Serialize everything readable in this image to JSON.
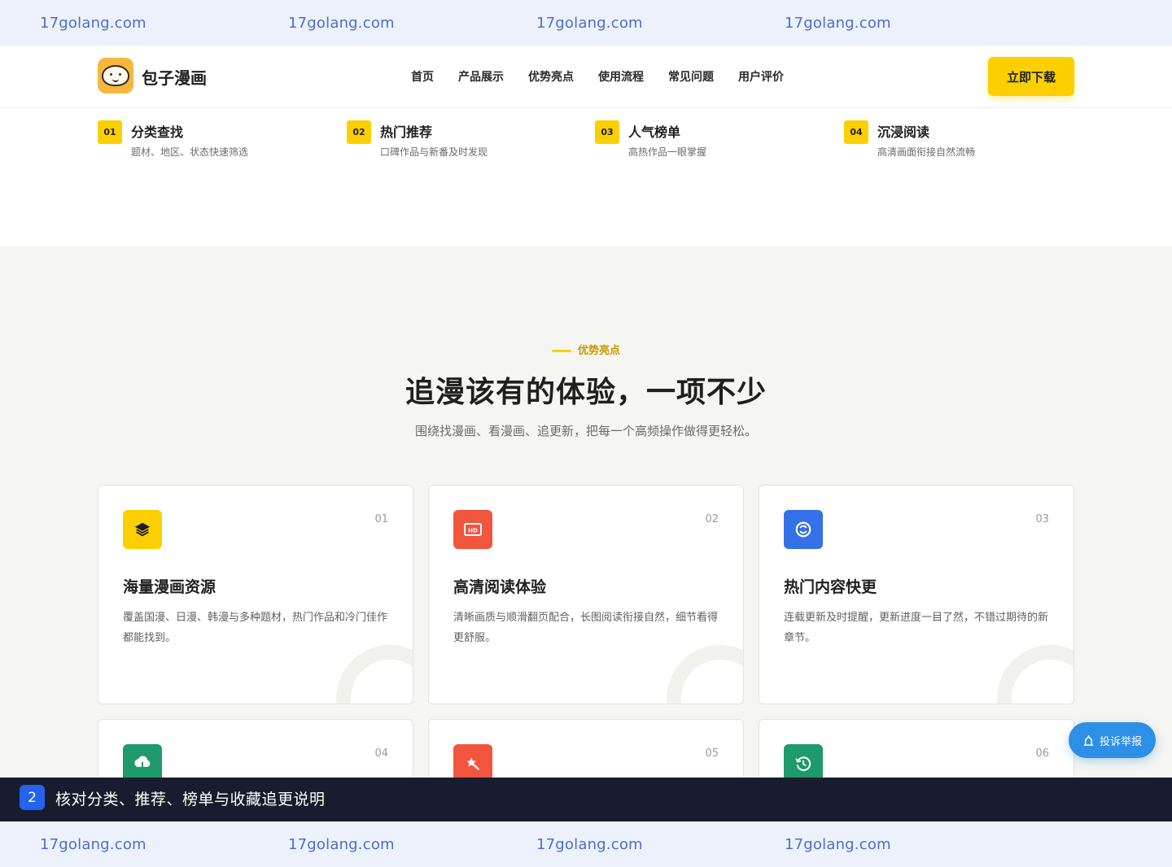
{
  "watermark": {
    "items": [
      "17golang.com",
      "17golang.com",
      "17golang.com",
      "17golang.com"
    ]
  },
  "header": {
    "brand": "包子漫画",
    "nav": [
      "首页",
      "产品展示",
      "优势亮点",
      "使用流程",
      "常见问题",
      "用户评价"
    ],
    "cta": "立即下载"
  },
  "features": [
    {
      "num": "01",
      "title": "分类查找",
      "desc": "题材、地区、状态快速筛选"
    },
    {
      "num": "02",
      "title": "热门推荐",
      "desc": "口碑作品与新番及时发现"
    },
    {
      "num": "03",
      "title": "人气榜单",
      "desc": "高热作品一眼掌握"
    },
    {
      "num": "04",
      "title": "沉浸阅读",
      "desc": "高清画面衔接自然流畅"
    }
  ],
  "section": {
    "eyebrow": "优势亮点",
    "title": "追漫该有的体验，一项不少",
    "subtitle": "围绕找漫画、看漫画、追更新，把每一个高频操作做得更轻松。"
  },
  "cards": [
    {
      "num": "01",
      "title": "海量漫画资源",
      "desc": "覆盖国漫、日漫、韩漫与多种题材，热门作品和冷门佳作都能找到。",
      "icon": "layers-icon",
      "color": "#fcd000"
    },
    {
      "num": "02",
      "title": "高清阅读体验",
      "desc": "清晰画质与顺滑翻页配合，长图阅读衔接自然，细节看得更舒服。",
      "icon": "hd-icon",
      "color": "#f2553d"
    },
    {
      "num": "03",
      "title": "热门内容快更",
      "desc": "连载更新及时提醒，更新进度一目了然，不错过期待的新章节。",
      "icon": "refresh-icon",
      "color": "#3470e6"
    },
    {
      "num": "04",
      "icon": "cloud-download-icon",
      "color": "#1f9a6b"
    },
    {
      "num": "05",
      "icon": "magic-wand-icon",
      "color": "#f2553d"
    },
    {
      "num": "06",
      "icon": "history-icon",
      "color": "#1f9a6b"
    }
  ],
  "report_button": {
    "label": "投诉举报",
    "icon": "report-icon"
  },
  "caption": {
    "badge": "2",
    "text": "核对分类、推荐、榜单与收藏追更说明"
  }
}
